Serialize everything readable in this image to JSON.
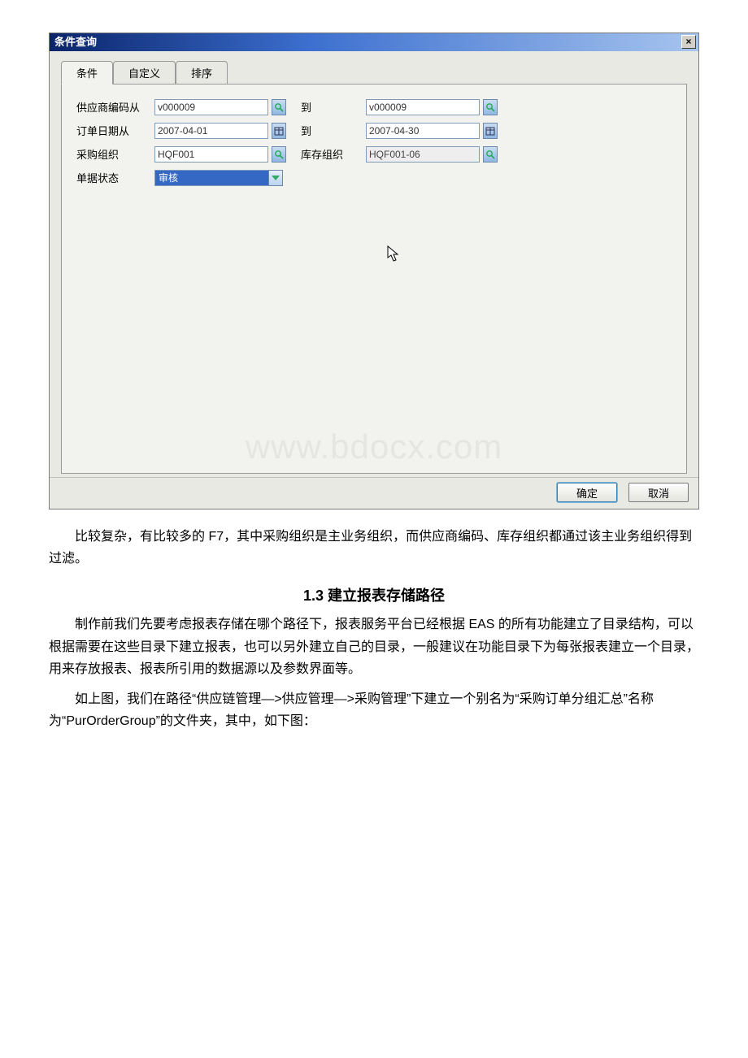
{
  "dialog": {
    "title": "条件查询",
    "close_label": "×",
    "tabs": [
      "条件",
      "自定义",
      "排序"
    ],
    "active_tab_index": 0,
    "rows": {
      "supplier_from_label": "供应商编码从",
      "supplier_from_value": "v000009",
      "supplier_to_label": "到",
      "supplier_to_value": "v000009",
      "date_from_label": "订单日期从",
      "date_from_value": "2007-04-01",
      "date_to_label": "到",
      "date_to_value": "2007-04-30",
      "purchase_org_label": "采购组织",
      "purchase_org_value": "HQF001",
      "storage_org_label": "库存组织",
      "storage_org_value": "HQF001-06",
      "status_label": "单据状态",
      "status_value": "审核"
    },
    "buttons": {
      "ok": "确定",
      "cancel": "取消"
    },
    "watermark": "www.bdocx.com"
  },
  "document": {
    "para1": "比较复杂，有比较多的 F7，其中采购组织是主业务组织，而供应商编码、库存组织都通过该主业务组织得到过滤。",
    "heading": "1.3 建立报表存储路径",
    "para2": "制作前我们先要考虑报表存储在哪个路径下，报表服务平台已经根据 EAS 的所有功能建立了目录结构，可以根据需要在这些目录下建立报表，也可以另外建立自己的目录，一般建议在功能目录下为每张报表建立一个目录，用来存放报表、报表所引用的数据源以及参数界面等。",
    "para3": "如上图，我们在路径“供应链管理—>供应管理—>采购管理”下建立一个别名为“采购订单分组汇总”名称为“PurOrderGroup”的文件夹，其中，如下图："
  }
}
